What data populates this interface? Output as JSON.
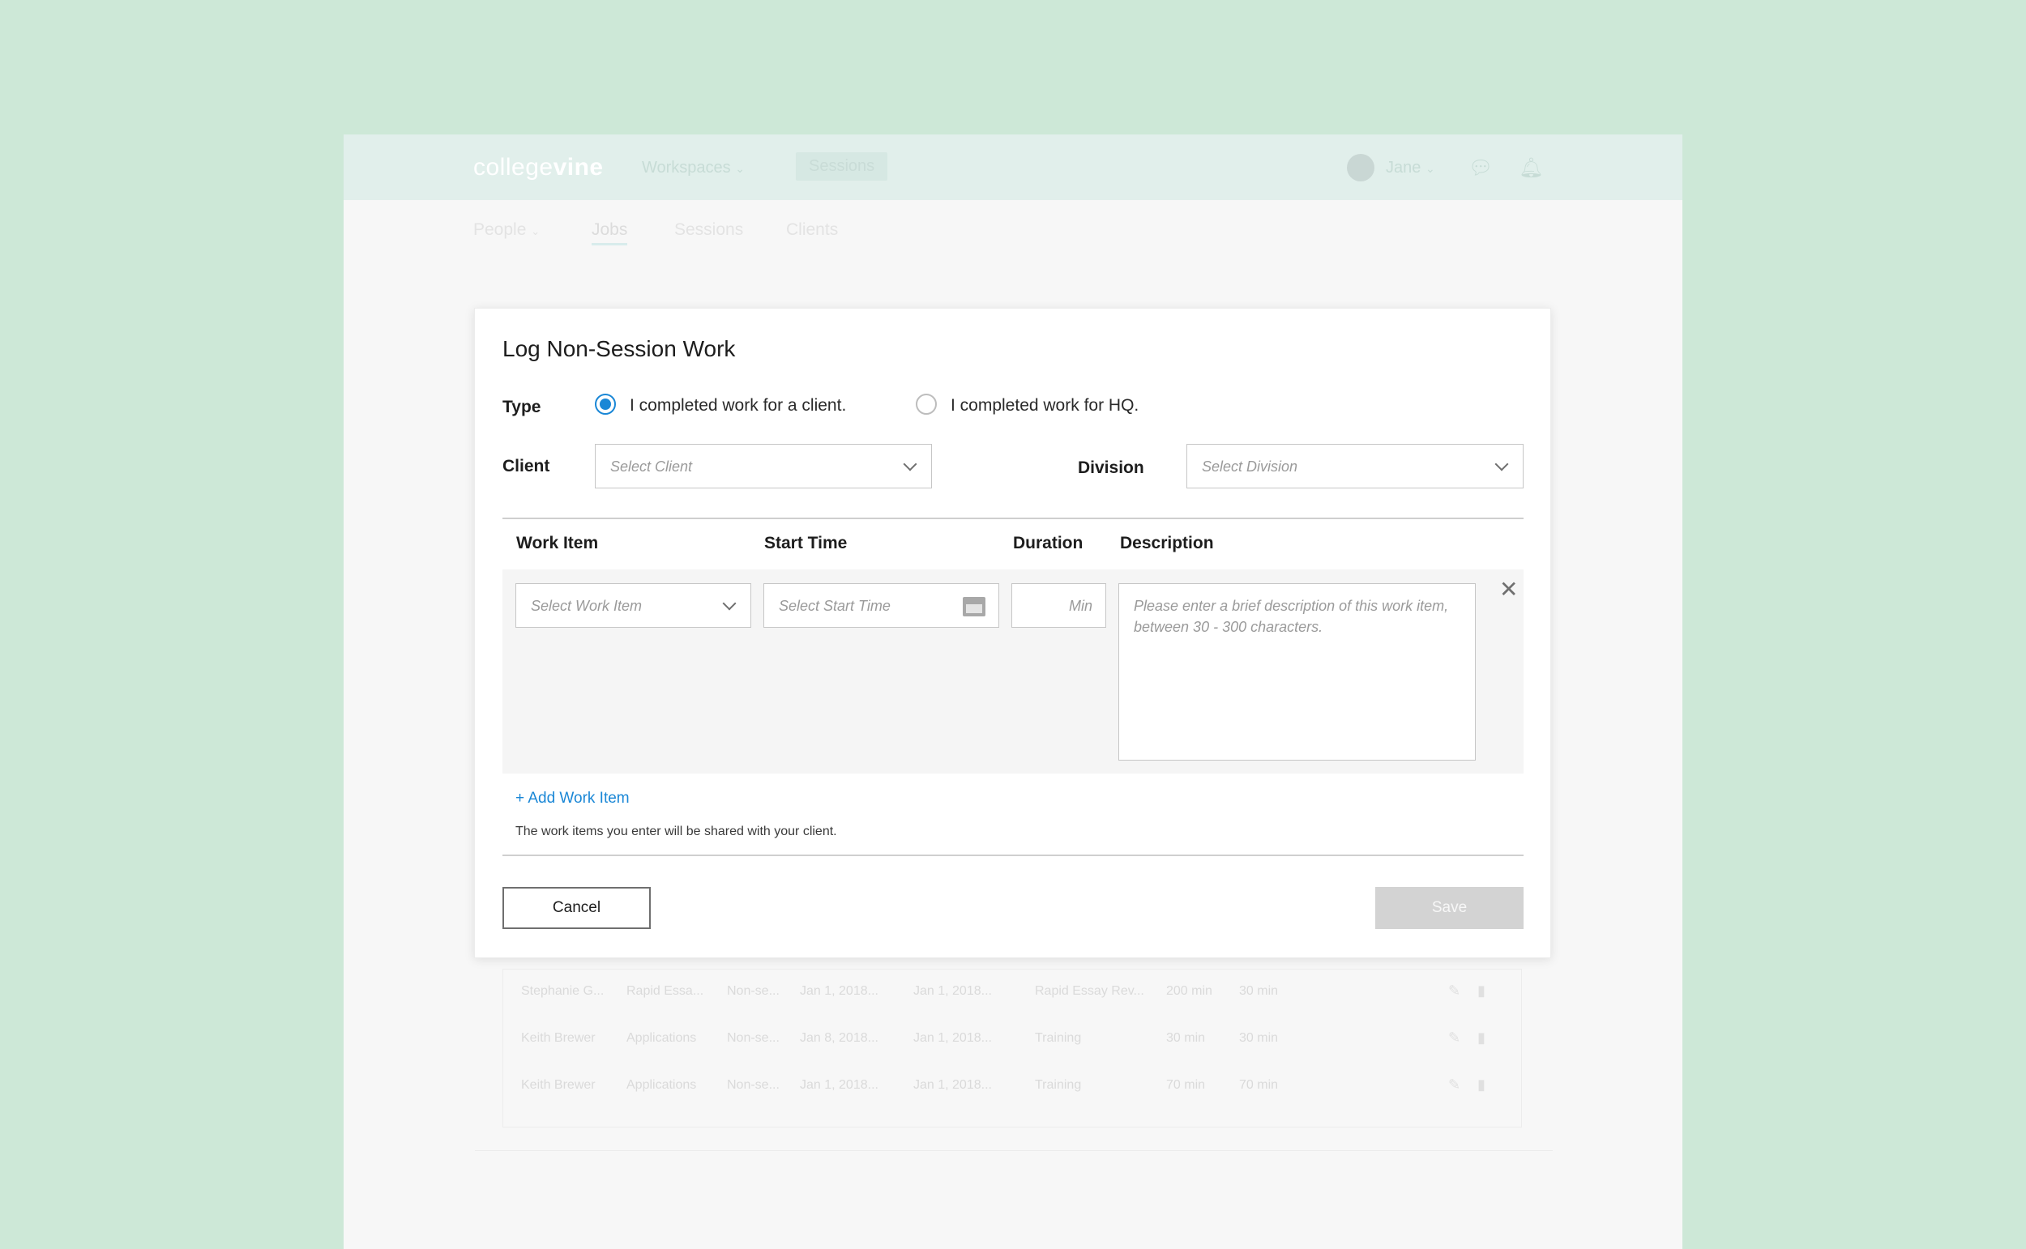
{
  "topbar": {
    "logo_light": "college",
    "logo_bold": "vine",
    "nav": [
      "Workspaces",
      "Sessions"
    ],
    "user_name": "Jane"
  },
  "subnav": [
    "People",
    "Jobs",
    "Sessions",
    "Clients"
  ],
  "background_table": {
    "rows": [
      [
        "Stephanie G...",
        "Rapid Essa...",
        "Non-se...",
        "Jan 1, 2018...",
        "Jan 1, 2018...",
        "Rapid Essay Rev...",
        "200 min",
        "30 min"
      ],
      [
        "Keith Brewer",
        "Applications",
        "Non-se...",
        "Jan 8, 2018...",
        "Jan 1, 2018...",
        "Training",
        "30 min",
        "30 min"
      ],
      [
        "Keith Brewer",
        "Applications",
        "Non-se...",
        "Jan 1, 2018...",
        "Jan 1, 2018...",
        "Training",
        "70 min",
        "70 min"
      ]
    ]
  },
  "modal": {
    "title": "Log Non-Session Work",
    "type_label": "Type",
    "type_options": [
      "I completed work for a client.",
      "I completed work for HQ."
    ],
    "type_selected": 0,
    "client_label": "Client",
    "client_placeholder": "Select Client",
    "division_label": "Division",
    "division_placeholder": "Select Division",
    "columns": [
      "Work Item",
      "Start Time",
      "Duration",
      "Description"
    ],
    "work_item_placeholder": "Select Work Item",
    "start_time_placeholder": "Select Start Time",
    "duration_placeholder": "Min",
    "description_placeholder": "Please enter a brief description of this work item, between 30 - 300 characters.",
    "add_work_item": "+ Add Work Item",
    "note": "The work items you enter will be shared with your client.",
    "cancel_label": "Cancel",
    "save_label": "Save"
  }
}
